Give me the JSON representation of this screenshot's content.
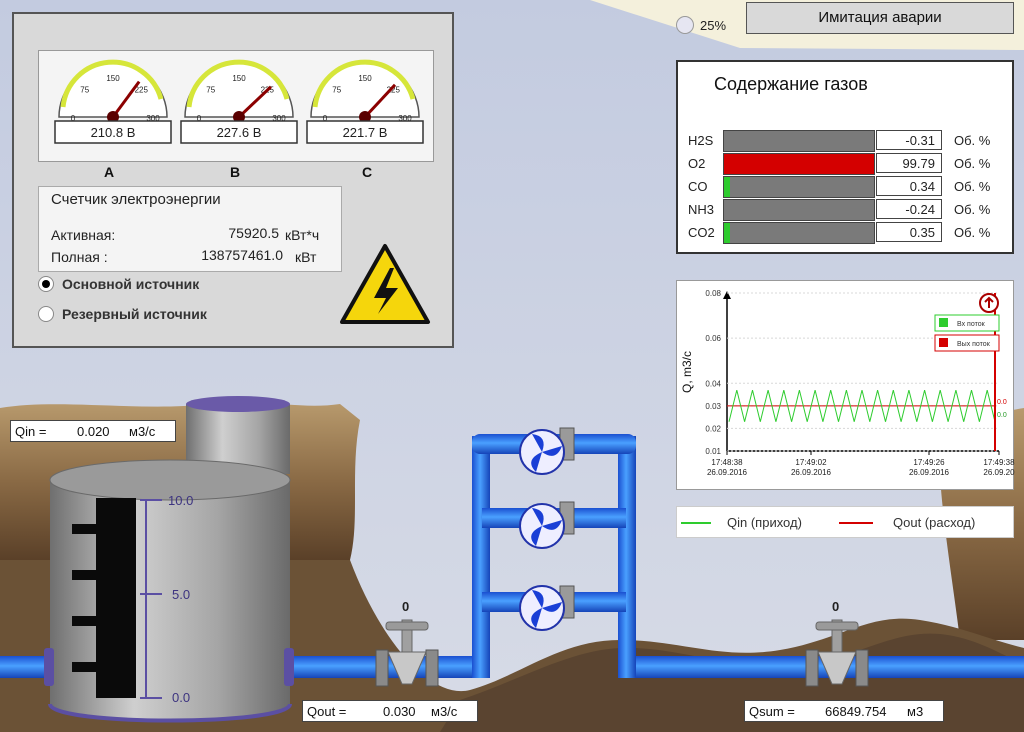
{
  "header": {
    "alarm_button": "Имитация аварии",
    "percent": "25%"
  },
  "voltmeters": {
    "ticks": [
      "0",
      "75",
      "150",
      "225",
      "300"
    ],
    "items": [
      {
        "reading": "210.8  В",
        "phase": "A",
        "value": 210.8
      },
      {
        "reading": "227.6  В",
        "phase": "B",
        "value": 227.6
      },
      {
        "reading": "221.7  В",
        "phase": "C",
        "value": 221.7
      }
    ]
  },
  "energy_meter": {
    "title": "Счетчик электроэнергии",
    "active_label": "Активная:",
    "active_value": "75920.5",
    "active_unit": "кВт*ч",
    "full_label": "Полная :",
    "full_value": "138757461.0",
    "full_unit": "кВт"
  },
  "source": {
    "main_label": "Основной источник",
    "reserve_label": "Резервный источник"
  },
  "gas": {
    "title": "Содержание газов",
    "rows": [
      {
        "name": "H2S",
        "value": "-0.31",
        "unit": "Об. %",
        "level": 0,
        "color": "#7a7a7a"
      },
      {
        "name": "O2",
        "value": "99.79",
        "unit": "Об. %",
        "level": 1,
        "color": "#d40000"
      },
      {
        "name": "CO",
        "value": "0.34",
        "unit": "Об. %",
        "level": 0.04,
        "color": "#2ecc2e"
      },
      {
        "name": "NH3",
        "value": "-0.24",
        "unit": "Об. %",
        "level": 0,
        "color": "#7a7a7a"
      },
      {
        "name": "CO2",
        "value": "0.35",
        "unit": "Об. %",
        "level": 0.04,
        "color": "#2ecc2e"
      }
    ]
  },
  "chart_data": {
    "type": "line",
    "ylabel": "Q, m3/c",
    "ylim": [
      0.01,
      0.08
    ],
    "yticks": [
      "0.08",
      "0.06",
      "0.04",
      "0.03",
      "0.02",
      "0.01"
    ],
    "xticks": [
      {
        "time": "17:48:38",
        "date": "26.09.2016"
      },
      {
        "time": "17:49:02",
        "date": "26.09.2016"
      },
      {
        "time": "17:49:26",
        "date": "26.09.2016"
      },
      {
        "time": "17:49:38",
        "date": "26.09.20"
      }
    ],
    "series": [
      {
        "name": "Вх поток",
        "color": "#2ecc2e",
        "min": 0.023,
        "max": 0.037,
        "cycles": 17
      },
      {
        "name": "Вых поток",
        "color": "#d40000",
        "value": 0.03
      }
    ],
    "right_labels": [
      "0.0",
      "0.0"
    ],
    "legend_placement": "top-right"
  },
  "chart_legend": {
    "qin": "Qin (приход)",
    "qout": "Qout (расход)",
    "qin_color": "#2ecc2e",
    "qout_color": "#d40000"
  },
  "tank": {
    "scale": [
      "10.0",
      "5.0",
      "0.0"
    ]
  },
  "valves": {
    "left_state": "0",
    "right_state": "0"
  },
  "readouts": {
    "qin_label": "Qin =",
    "qin_value": "0.020",
    "qin_unit": "м3/с",
    "qout_label": "Qout =",
    "qout_value": "0.030",
    "qout_unit": "м3/с",
    "qsum_label": "Qsum =",
    "qsum_value": "66849.754",
    "qsum_unit": "м3"
  }
}
